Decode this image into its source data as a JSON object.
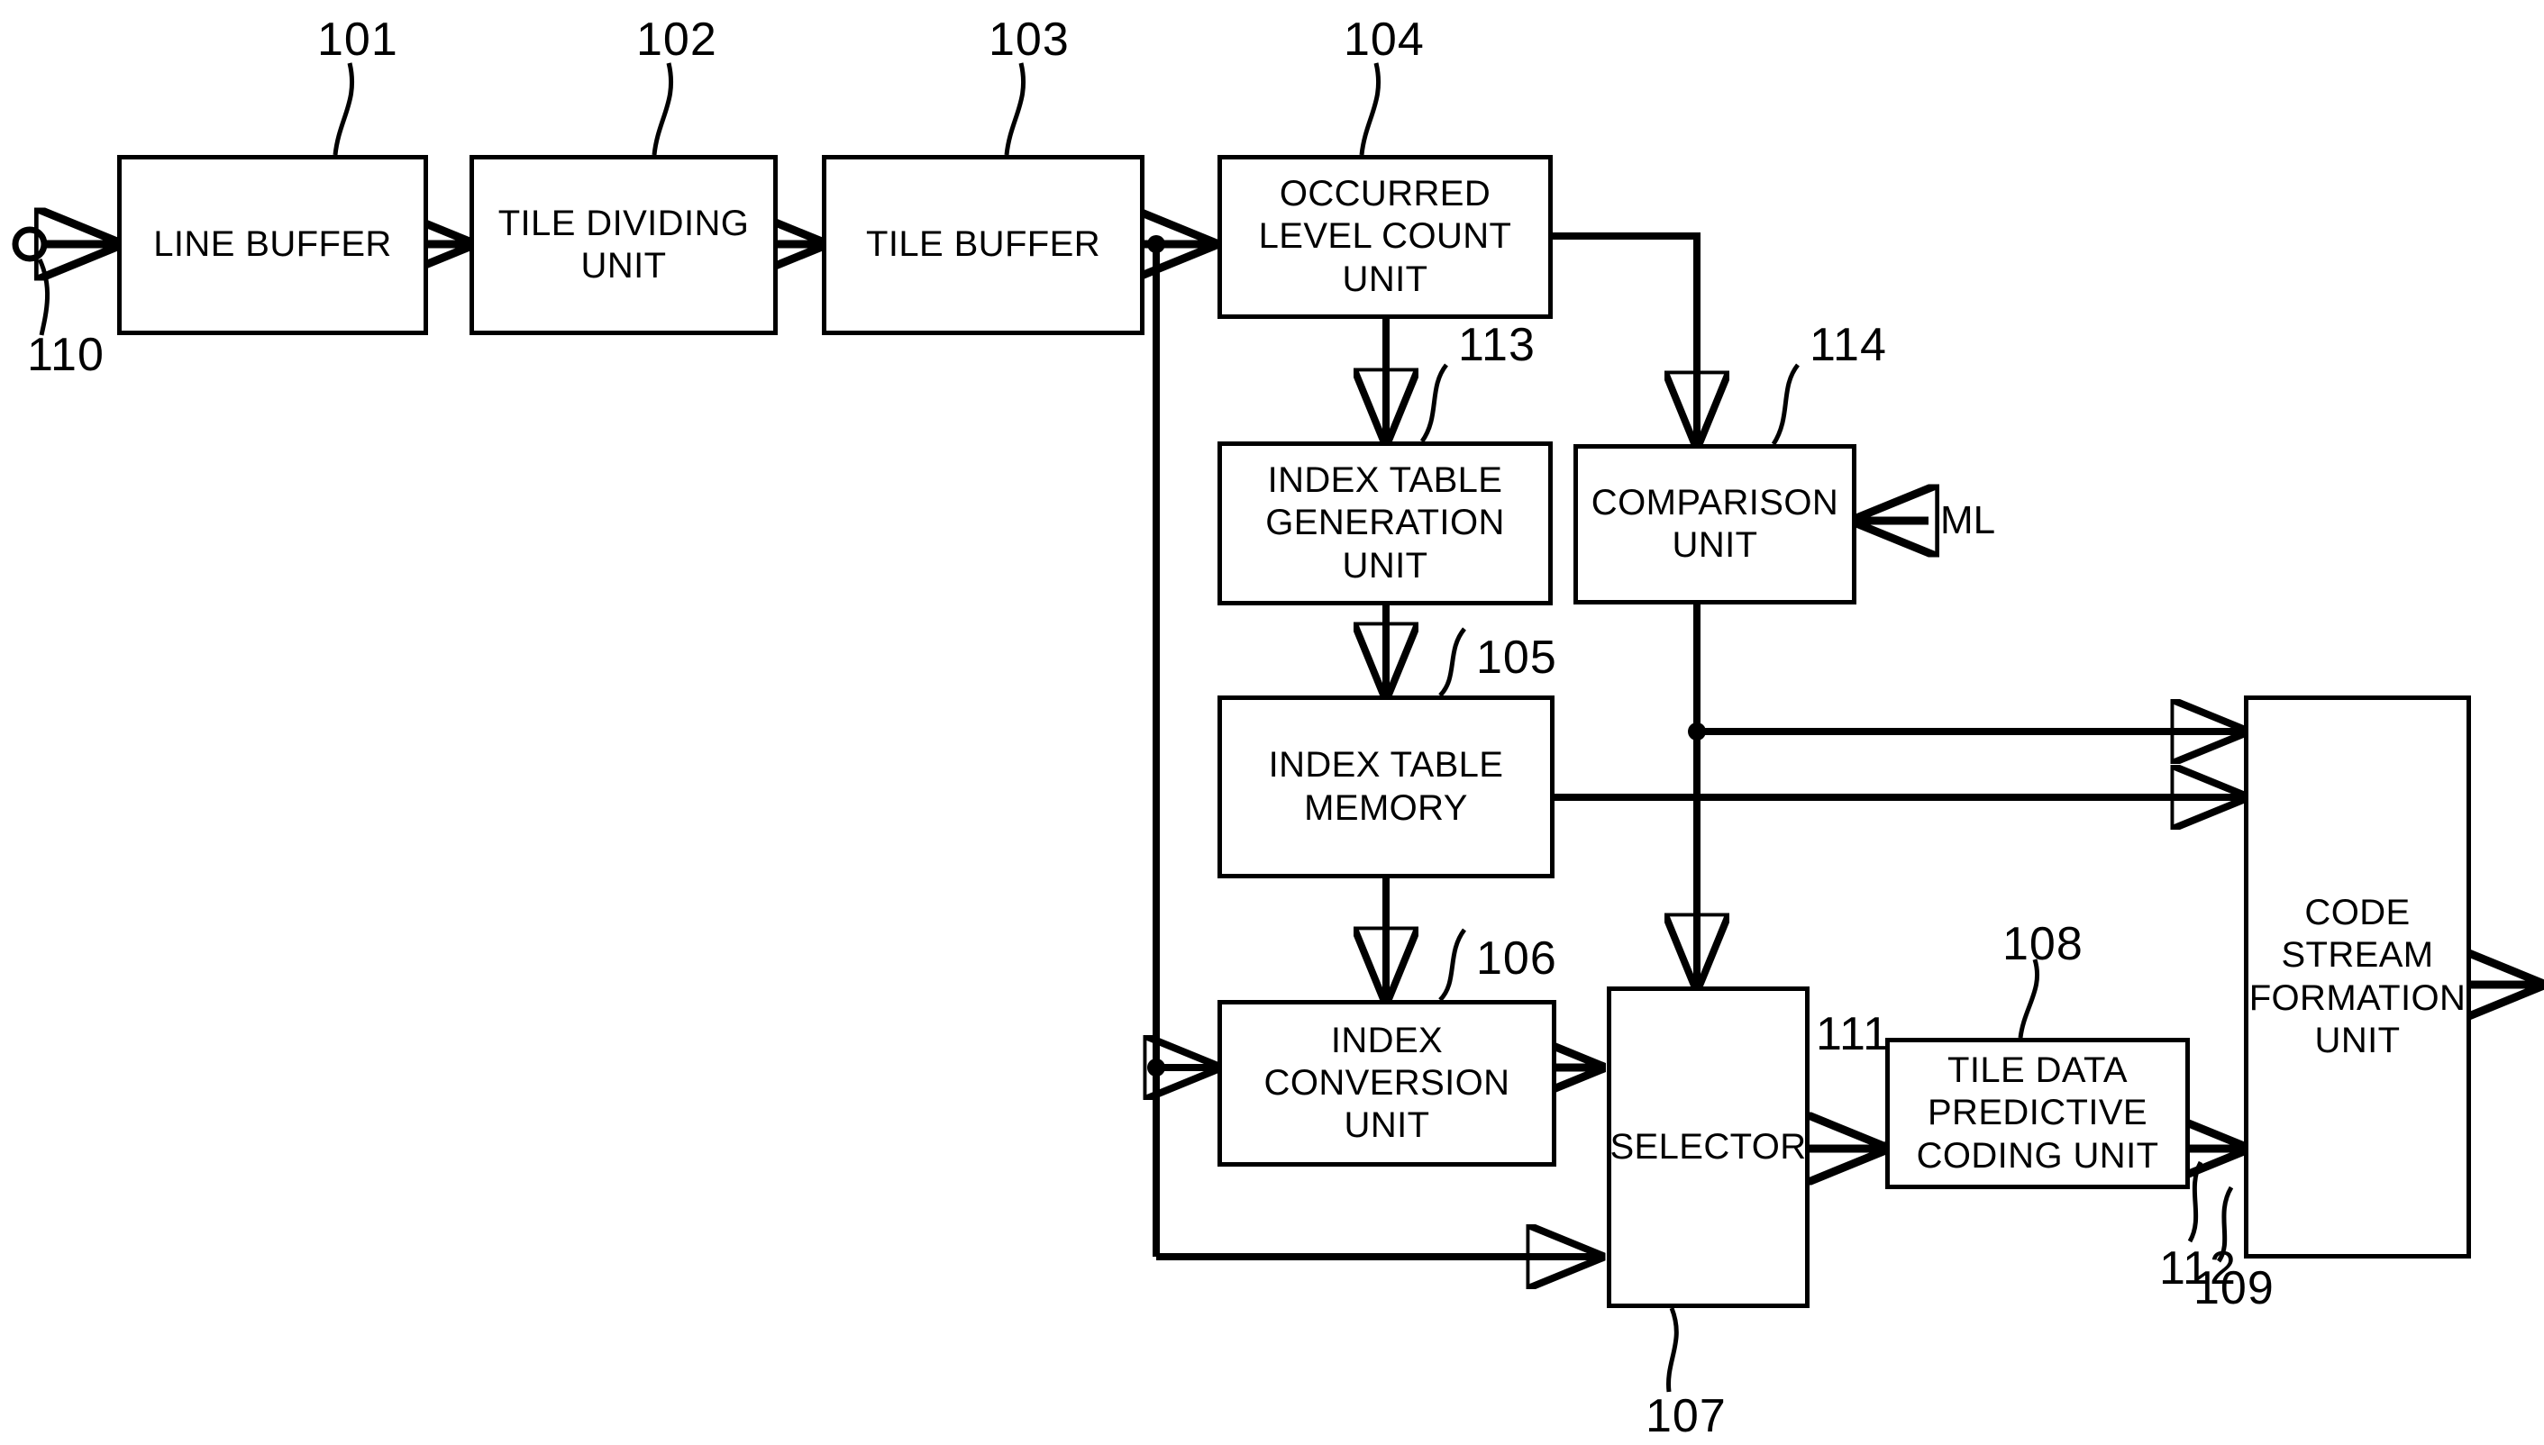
{
  "figure": {
    "type": "block-diagram",
    "title_visible": false
  },
  "blocks": [
    {
      "id": "line-buffer",
      "label": "LINE BUFFER",
      "ref": "101"
    },
    {
      "id": "tile-dividing-unit",
      "label": "TILE DIVIDING\nUNIT",
      "ref": "102"
    },
    {
      "id": "tile-buffer",
      "label": "TILE BUFFER",
      "ref": "103"
    },
    {
      "id": "occurred-level-count",
      "label": "OCCURRED\nLEVEL COUNT\nUNIT",
      "ref": "104"
    },
    {
      "id": "index-table-generation",
      "label": "INDEX TABLE\nGENERATION\nUNIT",
      "ref": "113"
    },
    {
      "id": "comparison-unit",
      "label": "COMPARISON\nUNIT",
      "ref": "114"
    },
    {
      "id": "index-table-memory",
      "label": "INDEX TABLE\nMEMORY",
      "ref": "105"
    },
    {
      "id": "index-conversion-unit",
      "label": "INDEX\nCONVERSION\nUNIT",
      "ref": "106"
    },
    {
      "id": "selector",
      "label": "SELECTOR",
      "ref": "107"
    },
    {
      "id": "tile-data-predictive",
      "label": "TILE DATA\nPREDICTIVE\nCODING UNIT",
      "ref": "108"
    },
    {
      "id": "code-stream-formation",
      "label": "CODE\nSTREAM\nFORMATION\nUNIT",
      "ref": "109"
    }
  ],
  "ref_labels": {
    "r101": "101",
    "r102": "102",
    "r103": "103",
    "r104": "104",
    "r105": "105",
    "r106": "106",
    "r107": "107",
    "r108": "108",
    "r109": "109",
    "r110": "110",
    "r111": "111",
    "r112": "112",
    "r113": "113",
    "r114": "114"
  },
  "signals": {
    "ml": "ML"
  },
  "colors": {
    "line": "#000000",
    "background": "#ffffff",
    "text": "#000000"
  }
}
